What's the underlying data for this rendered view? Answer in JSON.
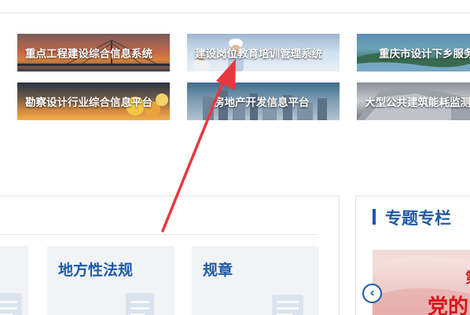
{
  "banners": [
    {
      "label": "重点工程建设综合信息系统"
    },
    {
      "label": "建设岗位教育培训管理系统"
    },
    {
      "label": "重庆市设计下乡服务"
    },
    {
      "label": "勘察设计行业综合信息平台"
    },
    {
      "label": "房地产开发信息平台"
    },
    {
      "label": "大型公共建筑能耗监测"
    }
  ],
  "laws": {
    "cards": [
      {
        "label": ""
      },
      {
        "label": "地方性法规"
      },
      {
        "label": "规章"
      }
    ]
  },
  "special": {
    "title": "专题专栏",
    "feature_text": "党的",
    "feature_top": "第"
  },
  "icons": {
    "prev": "chevron-left-icon",
    "doc": "document-icon"
  },
  "colors": {
    "accent": "#1e5aa8",
    "annotation_arrow": "#e8383d",
    "feature_red": "#d7141a"
  }
}
